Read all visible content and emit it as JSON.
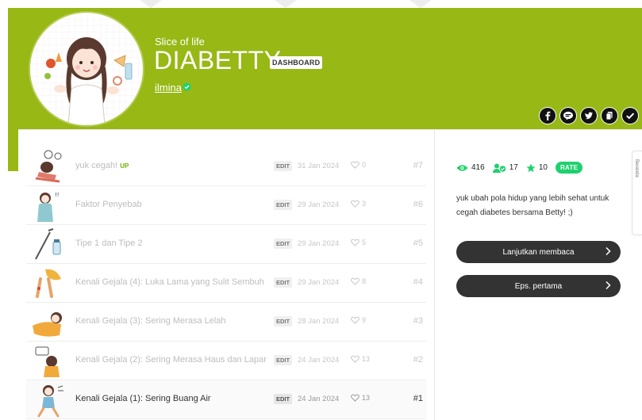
{
  "header": {
    "kicker": "Slice of life",
    "title": "DIABETTY",
    "dashboard_badge": "DASHBOARD",
    "author": "ilmina"
  },
  "share": [
    "facebook-icon",
    "line-icon",
    "twitter-icon",
    "copy-link-icon",
    "check-icon"
  ],
  "episodes": [
    {
      "title": "yuk cegah!",
      "up": "UP",
      "edit": "EDIT",
      "date": "31 Jan 2024",
      "likes": "0",
      "num": "#7"
    },
    {
      "title": "Faktor Penyebab",
      "edit": "EDIT",
      "date": "29 Jan 2024",
      "likes": "3",
      "num": "#6"
    },
    {
      "title": "Tipe 1 dan Tipe 2",
      "edit": "EDIT",
      "date": "29 Jan 2024",
      "likes": "5",
      "num": "#5"
    },
    {
      "title": "Kenali Gejala (4): Luka Lama yang Sulit Sembuh",
      "edit": "EDIT",
      "date": "29 Jan 2024",
      "likes": "8",
      "num": "#4"
    },
    {
      "title": "Kenali Gejala (3): Sering Merasa Lelah",
      "edit": "EDIT",
      "date": "28 Jan 2024",
      "likes": "9",
      "num": "#3"
    },
    {
      "title": "Kenali Gejala (2): Sering Merasa Haus dan Lapar",
      "edit": "EDIT",
      "date": "24 Jan 2024",
      "likes": "13",
      "num": "#2"
    },
    {
      "title": "Kenali Gejala (1): Sering Buang Air",
      "edit": "EDIT",
      "date": "24 Jan 2024",
      "likes": "13",
      "num": "#1"
    }
  ],
  "stats": {
    "views": "416",
    "subscribers": "17",
    "rating": "10",
    "rate_label": "RATE"
  },
  "synopsis": "yuk ubah pola hidup yang lebih sehat untuk cegah diabetes bersama Betty! ;)",
  "buttons": {
    "continue": "Lanjutkan membaca",
    "first": "Eps. pertama"
  },
  "edge_tab": "Beranda",
  "colors": {
    "brand_green": "#97b815",
    "rate_green": "#1fd16e",
    "dark": "#333333"
  }
}
